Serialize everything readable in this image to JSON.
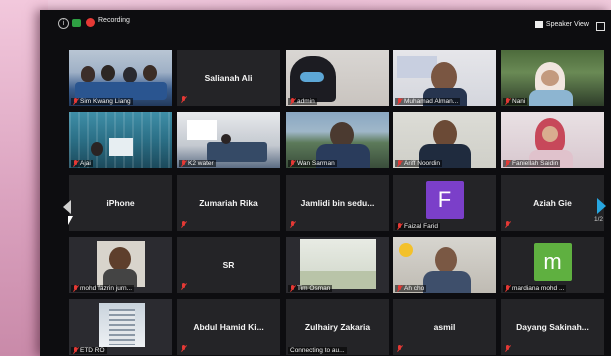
{
  "topbar": {
    "recording_label": "Recording",
    "speaker_view_label": "Speaker View"
  },
  "pagination": {
    "page": "1/2"
  },
  "tiles": {
    "r1": [
      {
        "name": "Sim Kwang Liang",
        "type": "video"
      },
      {
        "name": "Salianah Ali",
        "type": "name"
      },
      {
        "name": "admin",
        "type": "video"
      },
      {
        "name": "Muhamad Alman...",
        "type": "video"
      },
      {
        "name": "Nani",
        "type": "video"
      }
    ],
    "r2": [
      {
        "name": "Ajai",
        "type": "video"
      },
      {
        "name": "K2 water",
        "type": "video"
      },
      {
        "name": "Wan Sarman",
        "type": "video"
      },
      {
        "name": "Ariff Noordin",
        "type": "video",
        "active_speaker": true
      },
      {
        "name": "Faniellah Saidin",
        "type": "video"
      }
    ],
    "r3": [
      {
        "name": "iPhone",
        "type": "name"
      },
      {
        "name": "Zumariah Rika",
        "type": "name"
      },
      {
        "name": "Jamlidi bin sedu...",
        "type": "name"
      },
      {
        "name": "Faizal Farid",
        "type": "avatar",
        "avatar_letter": "F",
        "avatar_color": "#7b3fc9"
      },
      {
        "name": "Aziah Gie",
        "type": "name"
      }
    ],
    "r4": [
      {
        "name": "mohd fazrin jurn...",
        "type": "video"
      },
      {
        "name": "SR",
        "type": "name"
      },
      {
        "name": "Tim Osman",
        "type": "video"
      },
      {
        "name": "Ah cho",
        "type": "video"
      },
      {
        "name": "mardiana mohd ...",
        "type": "avatar",
        "avatar_letter": "m",
        "avatar_color": "#5fb040"
      }
    ],
    "r5": [
      {
        "name": "ETD RO",
        "type": "video"
      },
      {
        "name": "Abdul Hamid Ki...",
        "type": "name"
      },
      {
        "name": "Zulhairy Zakaria",
        "type": "name",
        "status": "Connecting to au..."
      },
      {
        "name": "asmil",
        "type": "name"
      },
      {
        "name": "Dayang Sakinah...",
        "type": "name"
      }
    ]
  },
  "colors": {
    "tile_bg": "#242427",
    "active_speaker": "#b5d334",
    "muted": "#e53935",
    "nav_arrow": "#27a6e0"
  }
}
